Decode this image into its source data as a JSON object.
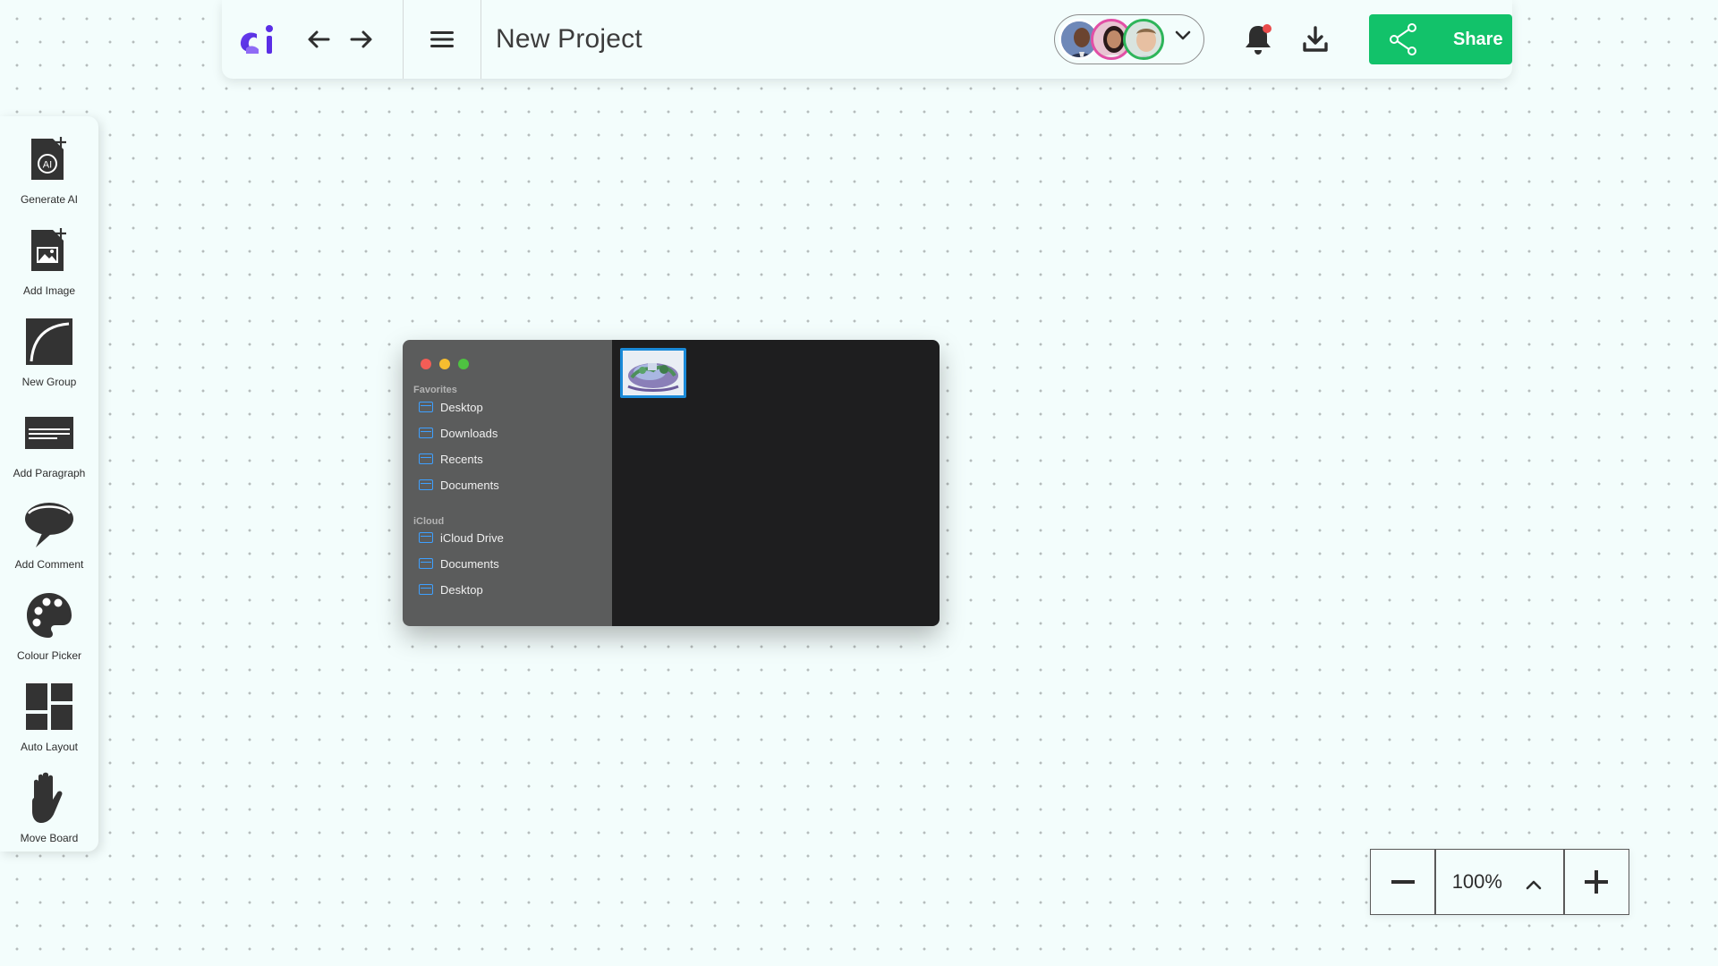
{
  "header": {
    "project_title": "New Project",
    "share_label": "Share",
    "logo_text": "ai",
    "notification_dot_color": "#e94b4b",
    "share_color": "#12c26a"
  },
  "toolbar": {
    "items": [
      {
        "label": "Generate AI",
        "icon": "generate-ai-icon"
      },
      {
        "label": "Add Image",
        "icon": "add-image-icon"
      },
      {
        "label": "New Group",
        "icon": "new-group-icon"
      },
      {
        "label": "Add Paragraph",
        "icon": "add-paragraph-icon"
      },
      {
        "label": "Add Comment",
        "icon": "add-comment-icon"
      },
      {
        "label": "Colour Picker",
        "icon": "colour-picker-icon"
      },
      {
        "label": "Auto Layout",
        "icon": "auto-layout-icon"
      },
      {
        "label": "Move Board",
        "icon": "move-board-icon"
      }
    ]
  },
  "finder": {
    "favorites_label": "Favorites",
    "favorites": [
      "Desktop",
      "Downloads",
      "Recents",
      "Documents"
    ],
    "icloud_label": "iCloud",
    "icloud": [
      "iCloud Drive",
      "Documents",
      "Desktop"
    ]
  },
  "zoom": {
    "value": "100%"
  }
}
